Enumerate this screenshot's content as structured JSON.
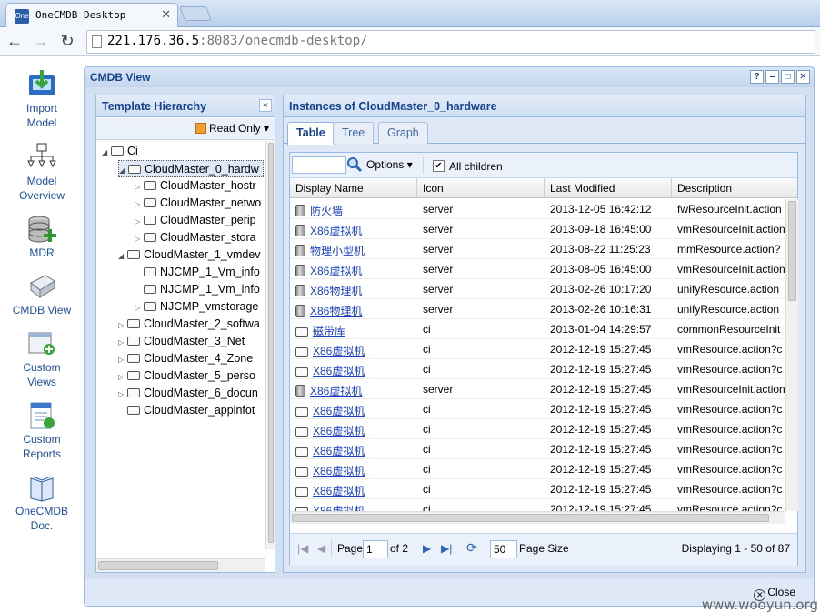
{
  "browser": {
    "tab_title": "OneCMDB Desktop",
    "favicon_text": "One",
    "url_host": "221.176.36.5",
    "url_rest": ":8083/onecmdb-desktop/"
  },
  "launcher": {
    "items": [
      {
        "label_1": "Import",
        "label_2": "Model",
        "icon": "import-model-icon"
      },
      {
        "label_1": "Model",
        "label_2": "Overview",
        "icon": "model-overview-icon"
      },
      {
        "label_1": "MDR",
        "label_2": "",
        "icon": "mdr-database-icon"
      },
      {
        "label_1": "CMDB View",
        "label_2": "",
        "icon": "cmdb-view-icon"
      },
      {
        "label_1": "Custom",
        "label_2": "Views",
        "icon": "custom-views-icon"
      },
      {
        "label_1": "Custom",
        "label_2": "Reports",
        "icon": "custom-reports-icon"
      },
      {
        "label_1": "OneCMDB",
        "label_2": "Doc.",
        "icon": "onecmdb-doc-icon"
      }
    ]
  },
  "window": {
    "title": "CMDB View",
    "close_label": "Close"
  },
  "tree": {
    "title": "Template Hierarchy",
    "read_only": "Read Only",
    "nodes": [
      {
        "label": "Ci",
        "depth": 0,
        "toggle": "expanded"
      },
      {
        "label": "CloudMaster_0_hardw",
        "depth": 1,
        "toggle": "expanded",
        "selected": true
      },
      {
        "label": "CloudMaster_hostr",
        "depth": 2,
        "toggle": "collapsed"
      },
      {
        "label": "CloudMaster_netwo",
        "depth": 2,
        "toggle": "collapsed"
      },
      {
        "label": "CloudMaster_perip",
        "depth": 2,
        "toggle": "collapsed"
      },
      {
        "label": "CloudMaster_stora",
        "depth": 2,
        "toggle": "collapsed"
      },
      {
        "label": "CloudMaster_1_vmdev",
        "depth": 1,
        "toggle": "expanded"
      },
      {
        "label": "NJCMP_1_Vm_info",
        "depth": 2,
        "toggle": "none"
      },
      {
        "label": "NJCMP_1_Vm_info",
        "depth": 2,
        "toggle": "none"
      },
      {
        "label": "NJCMP_vmstorage",
        "depth": 2,
        "toggle": "collapsed"
      },
      {
        "label": "CloudMaster_2_softwa",
        "depth": 1,
        "toggle": "collapsed"
      },
      {
        "label": "CloudMaster_3_Net",
        "depth": 1,
        "toggle": "collapsed"
      },
      {
        "label": "CloudMaster_4_Zone",
        "depth": 1,
        "toggle": "collapsed"
      },
      {
        "label": "CloudMaster_5_perso",
        "depth": 1,
        "toggle": "collapsed"
      },
      {
        "label": "CloudMaster_6_docun",
        "depth": 1,
        "toggle": "collapsed"
      },
      {
        "label": "CloudMaster_appinfot",
        "depth": 1,
        "toggle": "none"
      }
    ]
  },
  "instances": {
    "title": "Instances of CloudMaster_0_hardware",
    "tabs": [
      "Table",
      "Tree",
      "Graph"
    ],
    "active_tab": "Table",
    "search_placeholder": "",
    "options_label": "Options",
    "all_children_label": "All children",
    "all_children_checked": true,
    "columns": [
      "Display Name",
      "Icon",
      "Last Modified",
      "Description"
    ],
    "rows": [
      {
        "name": "防火墙",
        "icon": "server",
        "modified": "2013-12-05 16:42:12",
        "desc": "fwResourceInit.action"
      },
      {
        "name": "X86虚拟机",
        "icon": "server",
        "modified": "2013-09-18 16:45:00",
        "desc": "vmResourceInit.action"
      },
      {
        "name": "物理小型机",
        "icon": "server",
        "modified": "2013-08-22 11:25:23",
        "desc": "mmResource.action?"
      },
      {
        "name": "X86虚拟机",
        "icon": "server",
        "modified": "2013-08-05 16:45:00",
        "desc": "vmResourceInit.action"
      },
      {
        "name": "X86物理机",
        "icon": "server",
        "modified": "2013-02-26 10:17:20",
        "desc": "unifyResource.action"
      },
      {
        "name": "X86物理机",
        "icon": "server",
        "modified": "2013-02-26 10:16:31",
        "desc": "unifyResource.action"
      },
      {
        "name": "磁带库",
        "icon": "ci",
        "modified": "2013-01-04 14:29:57",
        "desc": "commonResourceInit"
      },
      {
        "name": "X86虚拟机",
        "icon": "ci",
        "modified": "2012-12-19 15:27:45",
        "desc": "vmResource.action?c"
      },
      {
        "name": "X86虚拟机",
        "icon": "ci",
        "modified": "2012-12-19 15:27:45",
        "desc": "vmResource.action?c"
      },
      {
        "name": "X86虚拟机",
        "icon": "server",
        "modified": "2012-12-19 15:27:45",
        "desc": "vmResourceInit.action"
      },
      {
        "name": "X86虚拟机",
        "icon": "ci",
        "modified": "2012-12-19 15:27:45",
        "desc": "vmResource.action?c"
      },
      {
        "name": "X86虚拟机",
        "icon": "ci",
        "modified": "2012-12-19 15:27:45",
        "desc": "vmResource.action?c"
      },
      {
        "name": "X86虚拟机",
        "icon": "ci",
        "modified": "2012-12-19 15:27:45",
        "desc": "vmResource.action?c"
      },
      {
        "name": "X86虚拟机",
        "icon": "ci",
        "modified": "2012-12-19 15:27:45",
        "desc": "vmResource.action?c"
      },
      {
        "name": "X86虚拟机",
        "icon": "ci",
        "modified": "2012-12-19 15:27:45",
        "desc": "vmResource.action?c"
      },
      {
        "name": "X86虚拟机",
        "icon": "ci",
        "modified": "2012-12-19 15:27:45",
        "desc": "vmResource.action?c"
      }
    ],
    "paging": {
      "page_label": "Page",
      "page_value": "1",
      "of_label": "of 2",
      "page_size_value": "50",
      "page_size_label": "Page Size",
      "displaying": "Displaying 1 - 50 of 87"
    }
  },
  "watermark": "www.wooyun.org"
}
